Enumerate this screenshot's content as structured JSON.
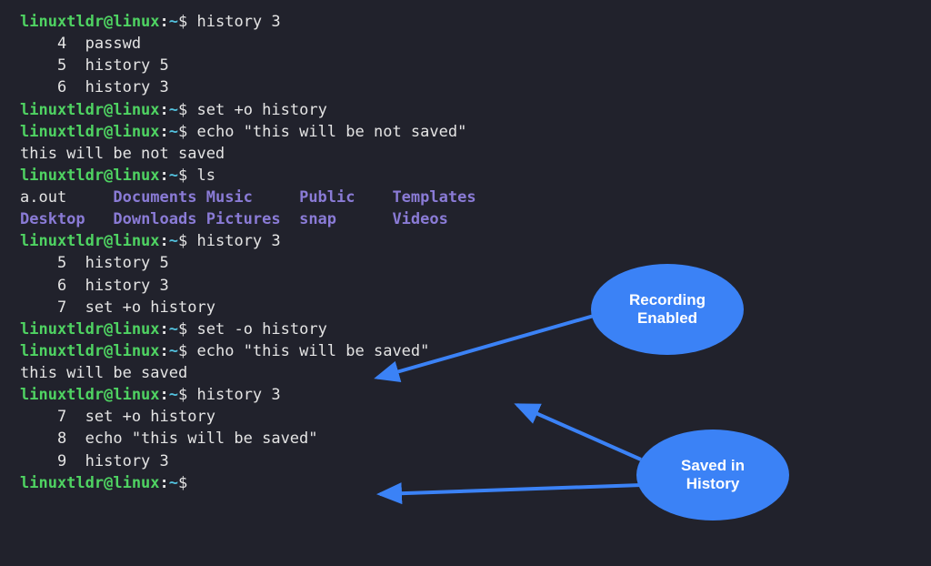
{
  "prompt": {
    "user": "linuxtldr@linux",
    "path": "~",
    "sep": ":",
    "sigil": "$"
  },
  "session": [
    {
      "kind": "cmd",
      "text": "history 3"
    },
    {
      "kind": "out",
      "text": "    4  passwd"
    },
    {
      "kind": "out",
      "text": "    5  history 5"
    },
    {
      "kind": "out",
      "text": "    6  history 3"
    },
    {
      "kind": "cmd",
      "text": "set +o history"
    },
    {
      "kind": "cmd",
      "text": "echo \"this will be not saved\""
    },
    {
      "kind": "out",
      "text": "this will be not saved"
    },
    {
      "kind": "cmd",
      "text": "ls"
    },
    {
      "kind": "ls",
      "row": 0
    },
    {
      "kind": "ls",
      "row": 1
    },
    {
      "kind": "cmd",
      "text": "history 3"
    },
    {
      "kind": "out",
      "text": "    5  history 5"
    },
    {
      "kind": "out",
      "text": "    6  history 3"
    },
    {
      "kind": "out",
      "text": "    7  set +o history"
    },
    {
      "kind": "cmd",
      "text": "set -o history"
    },
    {
      "kind": "cmd",
      "text": "echo \"this will be saved\""
    },
    {
      "kind": "out",
      "text": "this will be saved"
    },
    {
      "kind": "cmd",
      "text": "history 3"
    },
    {
      "kind": "out",
      "text": "    7  set +o history"
    },
    {
      "kind": "out",
      "text": "    8  echo \"this will be saved\""
    },
    {
      "kind": "out",
      "text": "    9  history 3"
    },
    {
      "kind": "cmd",
      "text": ""
    }
  ],
  "ls_rows": [
    [
      {
        "t": "a.out",
        "dir": false
      },
      {
        "t": "Documents",
        "dir": true
      },
      {
        "t": "Music",
        "dir": true
      },
      {
        "t": "Public",
        "dir": true
      },
      {
        "t": "Templates",
        "dir": true
      }
    ],
    [
      {
        "t": "Desktop",
        "dir": true
      },
      {
        "t": "Downloads",
        "dir": true
      },
      {
        "t": "Pictures",
        "dir": true
      },
      {
        "t": "snap",
        "dir": true
      },
      {
        "t": "Videos",
        "dir": true
      }
    ]
  ],
  "ls_col_width": 10,
  "annotations": {
    "bubble1_l1": "Recording",
    "bubble1_l2": "Enabled",
    "bubble2_l1": "Saved in",
    "bubble2_l2": "History"
  },
  "colors": {
    "bg": "#21222c",
    "user": "#4fd362",
    "path": "#53c1de",
    "dir": "#8a7bd6",
    "text": "#e4e4e4",
    "accent": "#3b82f6"
  }
}
